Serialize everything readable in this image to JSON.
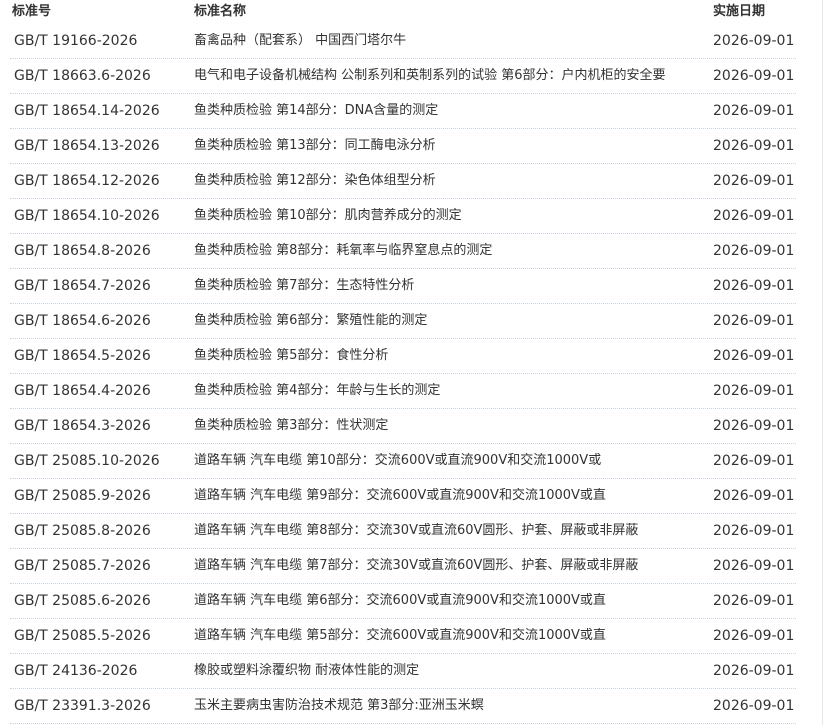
{
  "table": {
    "headers": {
      "code": "标准号",
      "name": "标准名称",
      "date": "实施日期"
    },
    "rows": [
      {
        "code": "GB/T 19166-2026",
        "name": "畜禽品种（配套系） 中国西门塔尔牛",
        "date": "2026-09-01"
      },
      {
        "code": "GB/T 18663.6-2026",
        "name": "电气和电子设备机械结构 公制系列和英制系列的试验 第6部分：户内机柜的安全要",
        "date": "2026-09-01"
      },
      {
        "code": "GB/T 18654.14-2026",
        "name": "鱼类种质检验 第14部分：DNA含量的测定",
        "date": "2026-09-01"
      },
      {
        "code": "GB/T 18654.13-2026",
        "name": "鱼类种质检验 第13部分：同工酶电泳分析",
        "date": "2026-09-01"
      },
      {
        "code": "GB/T 18654.12-2026",
        "name": "鱼类种质检验 第12部分：染色体组型分析",
        "date": "2026-09-01"
      },
      {
        "code": "GB/T 18654.10-2026",
        "name": "鱼类种质检验 第10部分：肌肉营养成分的测定",
        "date": "2026-09-01"
      },
      {
        "code": "GB/T 18654.8-2026",
        "name": "鱼类种质检验 第8部分：耗氧率与临界窒息点的测定",
        "date": "2026-09-01"
      },
      {
        "code": "GB/T 18654.7-2026",
        "name": "鱼类种质检验 第7部分：生态特性分析",
        "date": "2026-09-01"
      },
      {
        "code": "GB/T 18654.6-2026",
        "name": "鱼类种质检验 第6部分：繁殖性能的测定",
        "date": "2026-09-01"
      },
      {
        "code": "GB/T 18654.5-2026",
        "name": "鱼类种质检验 第5部分：食性分析",
        "date": "2026-09-01"
      },
      {
        "code": "GB/T 18654.4-2026",
        "name": "鱼类种质检验 第4部分：年龄与生长的测定",
        "date": "2026-09-01"
      },
      {
        "code": "GB/T 18654.3-2026",
        "name": "鱼类种质检验 第3部分：性状测定",
        "date": "2026-09-01"
      },
      {
        "code": "GB/T 25085.10-2026",
        "name": "道路车辆 汽车电缆 第10部分：交流600V或直流900V和交流1000V或",
        "date": "2026-09-01"
      },
      {
        "code": "GB/T 25085.9-2026",
        "name": "道路车辆 汽车电缆 第9部分：交流600V或直流900V和交流1000V或直",
        "date": "2026-09-01"
      },
      {
        "code": "GB/T 25085.8-2026",
        "name": "道路车辆 汽车电缆 第8部分：交流30V或直流60V圆形、护套、屏蔽或非屏蔽",
        "date": "2026-09-01"
      },
      {
        "code": "GB/T 25085.7-2026",
        "name": "道路车辆 汽车电缆 第7部分：交流30V或直流60V圆形、护套、屏蔽或非屏蔽",
        "date": "2026-09-01"
      },
      {
        "code": "GB/T 25085.6-2026",
        "name": "道路车辆 汽车电缆 第6部分：交流600V或直流900V和交流1000V或直",
        "date": "2026-09-01"
      },
      {
        "code": "GB/T 25085.5-2026",
        "name": "道路车辆 汽车电缆 第5部分：交流600V或直流900V和交流1000V或直",
        "date": "2026-09-01"
      },
      {
        "code": "GB/T 24136-2026",
        "name": "橡胶或塑料涂覆织物 耐液体性能的测定",
        "date": "2026-09-01"
      },
      {
        "code": "GB/T 23391.3-2026",
        "name": "玉米主要病虫害防治技术规范 第3部分:亚洲玉米螟",
        "date": "2026-09-01"
      }
    ]
  }
}
